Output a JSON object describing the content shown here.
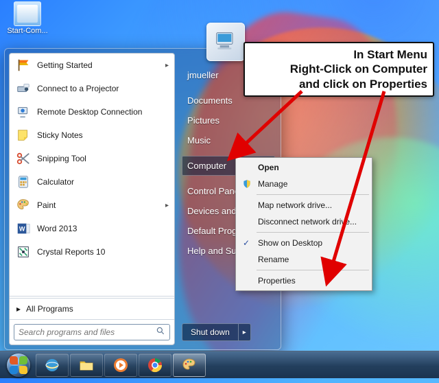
{
  "desktop": {
    "shortcut_label": "Start-Com..."
  },
  "start_menu": {
    "programs": [
      {
        "label": "Getting Started",
        "has_submenu": true,
        "icon": "flag"
      },
      {
        "label": "Connect to a Projector",
        "has_submenu": false,
        "icon": "projector"
      },
      {
        "label": "Remote Desktop Connection",
        "has_submenu": false,
        "icon": "rdp"
      },
      {
        "label": "Sticky Notes",
        "has_submenu": false,
        "icon": "sticky"
      },
      {
        "label": "Snipping Tool",
        "has_submenu": false,
        "icon": "snip"
      },
      {
        "label": "Calculator",
        "has_submenu": false,
        "icon": "calc"
      },
      {
        "label": "Paint",
        "has_submenu": true,
        "icon": "paint"
      },
      {
        "label": "Word 2013",
        "has_submenu": false,
        "icon": "word"
      },
      {
        "label": "Crystal Reports 10",
        "has_submenu": false,
        "icon": "crystal"
      }
    ],
    "all_programs_label": "All Programs",
    "search_placeholder": "Search programs and files",
    "right": {
      "username": "jmueller",
      "items": [
        "Documents",
        "Pictures",
        "Music",
        "Computer",
        "Control Panel",
        "Devices and Printers",
        "Default Programs",
        "Help and Support"
      ],
      "selected_index": 3
    },
    "shutdown_label": "Shut down"
  },
  "context_menu": {
    "open": "Open",
    "manage": "Manage",
    "map_drive": "Map network drive...",
    "disconnect_drive": "Disconnect network drive...",
    "show_on_desktop": "Show on Desktop",
    "rename": "Rename",
    "properties": "Properties",
    "show_on_desktop_checked": true
  },
  "callout": {
    "line1": "In Start Menu",
    "line2": "Right-Click on Computer",
    "line3": "and click on Properties"
  },
  "colors": {
    "arrow": "#e00000"
  }
}
